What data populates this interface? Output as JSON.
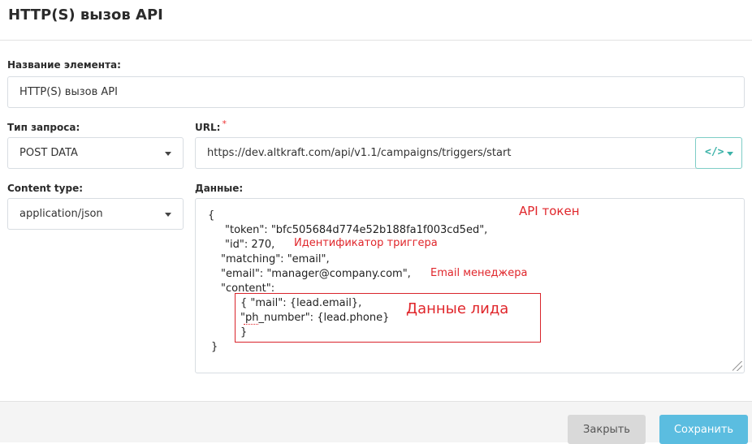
{
  "dialog": {
    "title": "HTTP(S) вызов API"
  },
  "element_name": {
    "label": "Название элемента:",
    "value": "HTTP(S) вызов API"
  },
  "request_type": {
    "label": "Тип запроса:",
    "selected": "POST DATA"
  },
  "url": {
    "label": "URL:",
    "required_mark": "*",
    "value": "https://dev.altkraft.com/api/v1.1/campaigns/triggers/start",
    "code_button_icon": "</>"
  },
  "content_type": {
    "label": "Content type:",
    "selected": "application/json"
  },
  "data": {
    "label": "Данные:",
    "lines": [
      "{",
      "\"token\": \"bfc505684d774e52b188fa1f003cd5ed\",",
      "\"id\": 270,",
      "\"matching\": \"email\",",
      "\"email\": \"manager@company.com\",",
      "\"content\":",
      "{ \"mail\": {lead.email},",
      "\"ph_number\": {lead.phone}",
      "}",
      "}"
    ]
  },
  "annotations": {
    "api_token": "API токен",
    "trigger_id": "Идентификатор триггера",
    "manager_email": "Email менеджера",
    "lead_data": "Данные лида",
    "color": "#e0262b"
  },
  "footer": {
    "close_label": "Закрыть",
    "save_label": "Сохранить"
  },
  "colors": {
    "accent_save": "#5bbde0",
    "accent_code": "#3bb2a8",
    "required": "#e33"
  }
}
